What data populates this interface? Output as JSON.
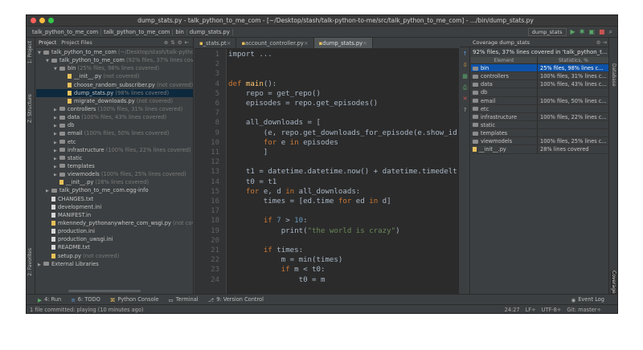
{
  "window": {
    "title": "dump_stats.py - talk_python_to_me_com - [~/Desktop/stash/talk-python-to-me/src/talk_python_to_me_com] - .../bin/dump_stats.py"
  },
  "breadcrumbs": [
    "talk_python_to_me_com",
    "talk_python_to_me_com",
    "bin",
    "dump_stats.py"
  ],
  "run_config": {
    "label": "dump_stats"
  },
  "left_stripe": {
    "project": "1: Project",
    "structure": "Z: Structure",
    "favorites": "2: Favorites"
  },
  "right_stripe": {
    "database": "Database",
    "coverage": "Coverage"
  },
  "project_panel": {
    "tab_project": "Project",
    "tab_files": "Project Files",
    "tree": [
      {
        "label": "talk_python_to_me_com",
        "extra": " (~/Desktop/stash/talk-python-to-me/src...",
        "kind": "folder",
        "level": 0,
        "open": true
      },
      {
        "label": "talk_python_to_me_com",
        "extra": " (92% files, 37% lines covered)",
        "kind": "folder",
        "level": 1,
        "open": true
      },
      {
        "label": "bin",
        "extra": " (25% files, 98% lines covered)",
        "kind": "folder",
        "level": 2,
        "open": true
      },
      {
        "label": "__init__.py",
        "extra": " (not covered)",
        "kind": "py",
        "level": 3
      },
      {
        "label": "choose_random_subscriber.py",
        "extra": " (not covered)",
        "kind": "py",
        "level": 3
      },
      {
        "label": "dump_stats.py",
        "extra": " (98% lines covered)",
        "kind": "py",
        "level": 3,
        "selected": true
      },
      {
        "label": "migrate_downloads.py",
        "extra": " (not covered)",
        "kind": "py",
        "level": 3
      },
      {
        "label": "controllers",
        "extra": " (100% files, 31% lines covered)",
        "kind": "folder",
        "level": 2
      },
      {
        "label": "data",
        "extra": " (100% files, 43% lines covered)",
        "kind": "folder",
        "level": 2
      },
      {
        "label": "db",
        "extra": "",
        "kind": "folder",
        "level": 2
      },
      {
        "label": "email",
        "extra": " (100% files, 50% lines covered)",
        "kind": "folder",
        "level": 2
      },
      {
        "label": "etc",
        "extra": "",
        "kind": "folder",
        "level": 2
      },
      {
        "label": "infrastructure",
        "extra": " (100% files, 22% lines covered)",
        "kind": "folder",
        "level": 2
      },
      {
        "label": "static",
        "extra": "",
        "kind": "folder",
        "level": 2
      },
      {
        "label": "templates",
        "extra": "",
        "kind": "folder",
        "level": 2
      },
      {
        "label": "viewmodels",
        "extra": " (100% files, 25% lines covered)",
        "kind": "folder",
        "level": 2
      },
      {
        "label": "__init__.py",
        "extra": " (28% lines covered)",
        "kind": "py",
        "level": 2
      },
      {
        "label": "talk_python_to_me_com.egg-info",
        "extra": "",
        "kind": "folder",
        "level": 1
      },
      {
        "label": "CHANGES.txt",
        "extra": "",
        "kind": "file",
        "level": 1
      },
      {
        "label": "development.ini",
        "extra": "",
        "kind": "file",
        "level": 1
      },
      {
        "label": "MANIFEST.in",
        "extra": "",
        "kind": "file",
        "level": 1
      },
      {
        "label": "mkennedy_pythonanywhere_com_wsgi.py",
        "extra": " (not cov...",
        "kind": "py",
        "level": 1
      },
      {
        "label": "production.ini",
        "extra": "",
        "kind": "file",
        "level": 1
      },
      {
        "label": "production_uwsgi.ini",
        "extra": "",
        "kind": "file",
        "level": 1
      },
      {
        "label": "README.txt",
        "extra": "",
        "kind": "file",
        "level": 1
      },
      {
        "label": "setup.py",
        "extra": " (not covered)",
        "kind": "py",
        "level": 1
      },
      {
        "label": "External Libraries",
        "extra": "",
        "kind": "folder",
        "level": 0
      }
    ]
  },
  "editor": {
    "tabs": [
      {
        "label": "_stats.pt",
        "active": false
      },
      {
        "label": "account_controller.py",
        "active": false
      },
      {
        "label": "dump_stats.py",
        "active": true
      }
    ],
    "line_numbers": [
      "1",
      "2",
      "3",
      "4",
      "5",
      "6",
      "7",
      "8",
      "9",
      "10",
      "11",
      "12",
      "13",
      "14",
      "15",
      "16",
      "17",
      "18",
      "19",
      "20",
      "21",
      "22",
      "23",
      "24"
    ],
    "lines": [
      [
        {
          "t": "import ...",
          "c": ""
        }
      ],
      [],
      [],
      [
        {
          "t": "def ",
          "c": "kw"
        },
        {
          "t": "main",
          "c": "fn"
        },
        {
          "t": "():",
          "c": ""
        }
      ],
      [
        {
          "t": "    repo = get_repo()",
          "c": ""
        }
      ],
      [
        {
          "t": "    episodes = repo.get_episodes()",
          "c": ""
        }
      ],
      [],
      [
        {
          "t": "    all_downloads = [",
          "c": ""
        }
      ],
      [
        {
          "t": "        (e, repo.get_downloads_for_episode(e.show_id",
          "c": ""
        }
      ],
      [
        {
          "t": "        ",
          "c": ""
        },
        {
          "t": "for ",
          "c": "kw"
        },
        {
          "t": "e ",
          "c": ""
        },
        {
          "t": "in ",
          "c": "kw"
        },
        {
          "t": "episodes",
          "c": ""
        }
      ],
      [
        {
          "t": "        ]",
          "c": ""
        }
      ],
      [],
      [
        {
          "t": "    t1 = datetime.datetime.now() + datetime.timedelt",
          "c": ""
        }
      ],
      [
        {
          "t": "    t0 = t1",
          "c": ""
        }
      ],
      [
        {
          "t": "    ",
          "c": ""
        },
        {
          "t": "for ",
          "c": "kw"
        },
        {
          "t": "e, d ",
          "c": ""
        },
        {
          "t": "in ",
          "c": "kw"
        },
        {
          "t": "all_downloads:",
          "c": ""
        }
      ],
      [
        {
          "t": "        times = [ed.time ",
          "c": ""
        },
        {
          "t": "for ",
          "c": "kw"
        },
        {
          "t": "ed ",
          "c": ""
        },
        {
          "t": "in ",
          "c": "kw"
        },
        {
          "t": "d]",
          "c": ""
        }
      ],
      [],
      [
        {
          "t": "        ",
          "c": ""
        },
        {
          "t": "if ",
          "c": "kw"
        },
        {
          "t": "7",
          "c": "num"
        },
        {
          "t": " > ",
          "c": ""
        },
        {
          "t": "10",
          "c": "num"
        },
        {
          "t": ":",
          "c": ""
        }
      ],
      [
        {
          "t": "            print(",
          "c": ""
        },
        {
          "t": "\"the world is crazy\"",
          "c": "str"
        },
        {
          "t": ")",
          "c": ""
        }
      ],
      [],
      [
        {
          "t": "        ",
          "c": ""
        },
        {
          "t": "if ",
          "c": "kw"
        },
        {
          "t": "times:",
          "c": ""
        }
      ],
      [
        {
          "t": "            m = min(times)",
          "c": ""
        }
      ],
      [
        {
          "t": "            ",
          "c": ""
        },
        {
          "t": "if ",
          "c": "kw"
        },
        {
          "t": "m < t0:",
          "c": ""
        }
      ],
      [
        {
          "t": "                t0 = m",
          "c": ""
        }
      ]
    ]
  },
  "coverage": {
    "title": "Coverage dump_stats",
    "summary": "92% files, 37% lines covered in 'talk_python_t...",
    "col_element": "Element",
    "col_stats": "Statistics, %",
    "rows": [
      {
        "name": "bin",
        "stat": "25% files, 98% lines c...",
        "selected": true
      },
      {
        "name": "controllers",
        "stat": "100% files, 31% lines c..."
      },
      {
        "name": "data",
        "stat": "100% files, 43% lines c..."
      },
      {
        "name": "db",
        "stat": ""
      },
      {
        "name": "email",
        "stat": "100% files, 50% lines c..."
      },
      {
        "name": "etc",
        "stat": ""
      },
      {
        "name": "infrastructure",
        "stat": "100% files, 22% lines c..."
      },
      {
        "name": "static",
        "stat": ""
      },
      {
        "name": "templates",
        "stat": ""
      },
      {
        "name": "viewmodels",
        "stat": "100% files, 25% lines c..."
      },
      {
        "name": "__init__.py",
        "stat": "28% lines covered"
      }
    ]
  },
  "bottom_tabs": {
    "run": "4: Run",
    "todo": "6: TODO",
    "console": "Python Console",
    "terminal": "Terminal",
    "vcs": "9: Version Control",
    "event_log": "Event Log"
  },
  "status": {
    "message": "1 file committed: playing (10 minutes ago)",
    "position": "24:27",
    "line_sep": "LF÷",
    "encoding": "UTF-8÷",
    "git": "Git: master÷"
  },
  "colors": {
    "selection": "#0d293e",
    "coverage_selection": "#0d52a8",
    "keyword": "#cc7832",
    "function": "#ffc66d",
    "string": "#6a8759",
    "number": "#6897bb"
  }
}
